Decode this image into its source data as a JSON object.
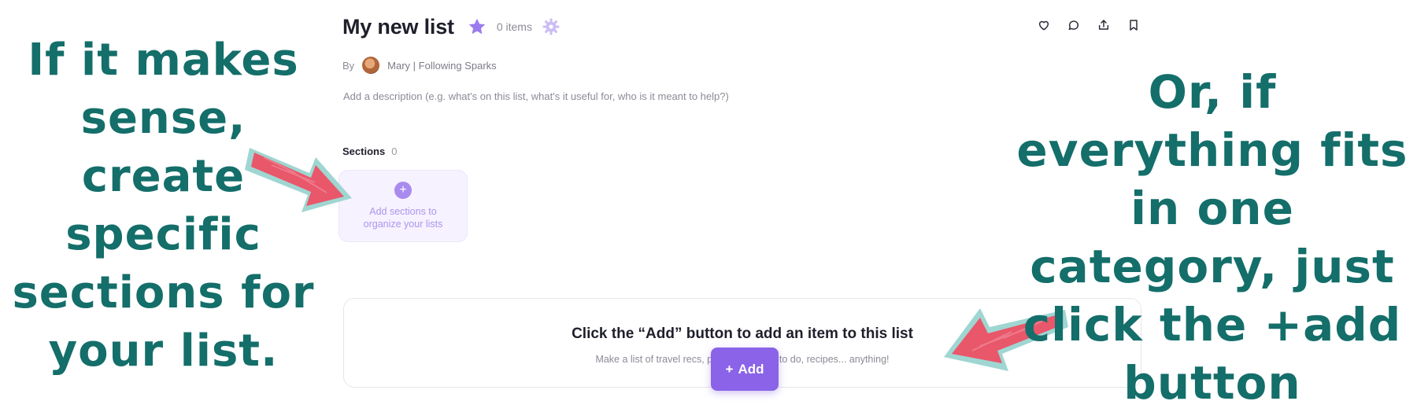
{
  "header": {
    "title": "My new list",
    "item_count": "0 items",
    "byline_prefix": "By",
    "author": "Mary | Following Sparks"
  },
  "description_placeholder": "Add a description (e.g. what's on this list, what's it useful for, who is it meant to help?)",
  "sections": {
    "label": "Sections",
    "count": "0",
    "add_card_text": "Add sections to organize your lists"
  },
  "empty_state": {
    "title": "Click the “Add” button to add an item to this list",
    "subtitle": "Make a list of travel recs, products, things to do, recipes... anything!"
  },
  "add_button": {
    "label": "Add"
  },
  "annotations": {
    "left": "If it makes sense, create specific sections for your list.",
    "right": "Or, if everything fits in one category, just click the +add button"
  },
  "colors": {
    "accent": "#8a63e8",
    "annotation_text": "#146e6a",
    "arrow_fill": "#e9576a",
    "arrow_outline": "#9fd6d2"
  },
  "icons": [
    "star-icon",
    "gear-icon",
    "heart-icon",
    "comment-icon",
    "share-icon",
    "bookmark-icon",
    "plus-icon",
    "arrow-icon"
  ]
}
